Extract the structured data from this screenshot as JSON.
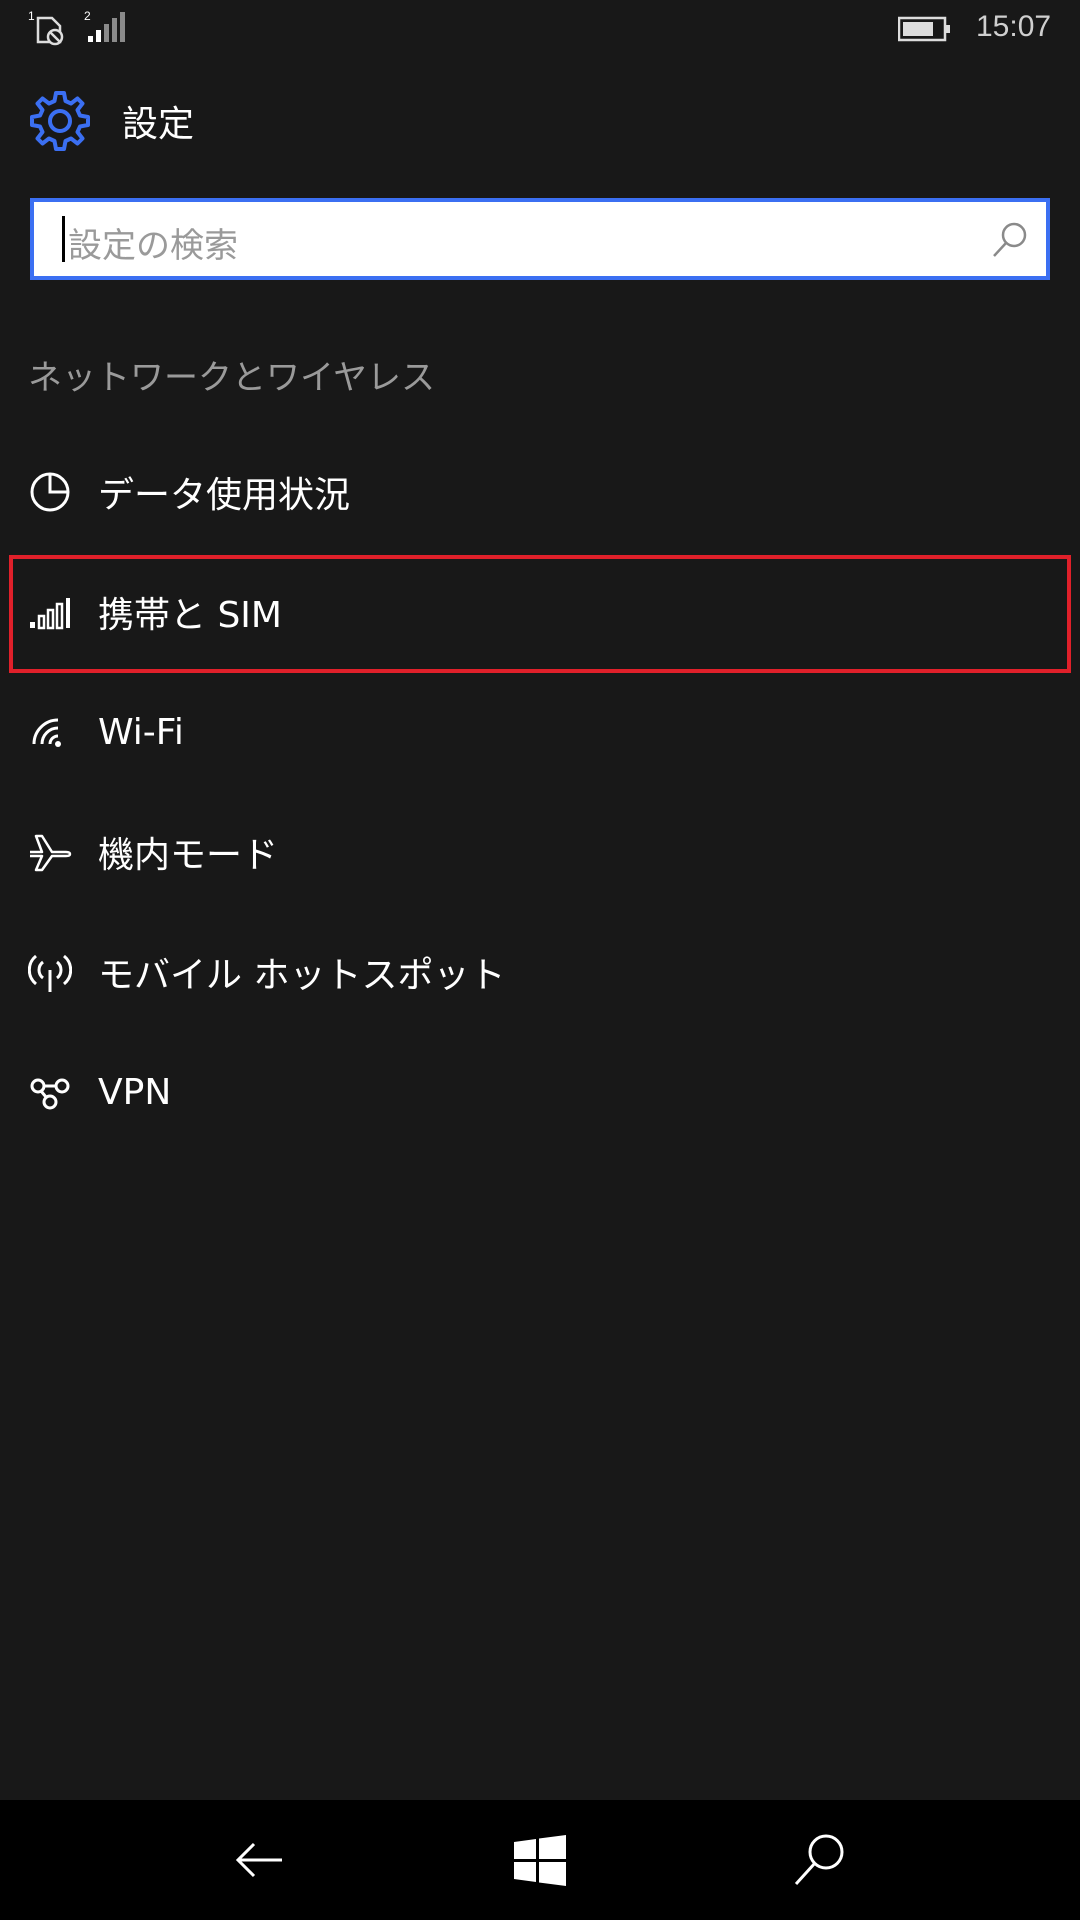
{
  "status_bar": {
    "sim1_label": "1",
    "sim2_label": "2",
    "time": "15:07"
  },
  "header": {
    "icon": "gear-icon",
    "title": "設定"
  },
  "search": {
    "placeholder": "設定の検索",
    "icon": "search-icon"
  },
  "section": {
    "title": "ネットワークとワイヤレス",
    "items": [
      {
        "label": "データ使用状況",
        "icon": "pie-chart-icon"
      },
      {
        "label": "携帯と SIM",
        "icon": "cellular-signal-icon"
      },
      {
        "label": "Wi-Fi",
        "icon": "wifi-icon"
      },
      {
        "label": "機内モード",
        "icon": "airplane-icon"
      },
      {
        "label": "モバイル ホットスポット",
        "icon": "hotspot-icon"
      },
      {
        "label": "VPN",
        "icon": "vpn-icon"
      }
    ]
  },
  "nav_bar": {
    "back_icon": "back-arrow-icon",
    "start_icon": "windows-logo-icon",
    "search_icon": "search-icon"
  },
  "colors": {
    "accent": "#3b6ff2",
    "highlight": "#e0202a",
    "background": "#181818"
  }
}
